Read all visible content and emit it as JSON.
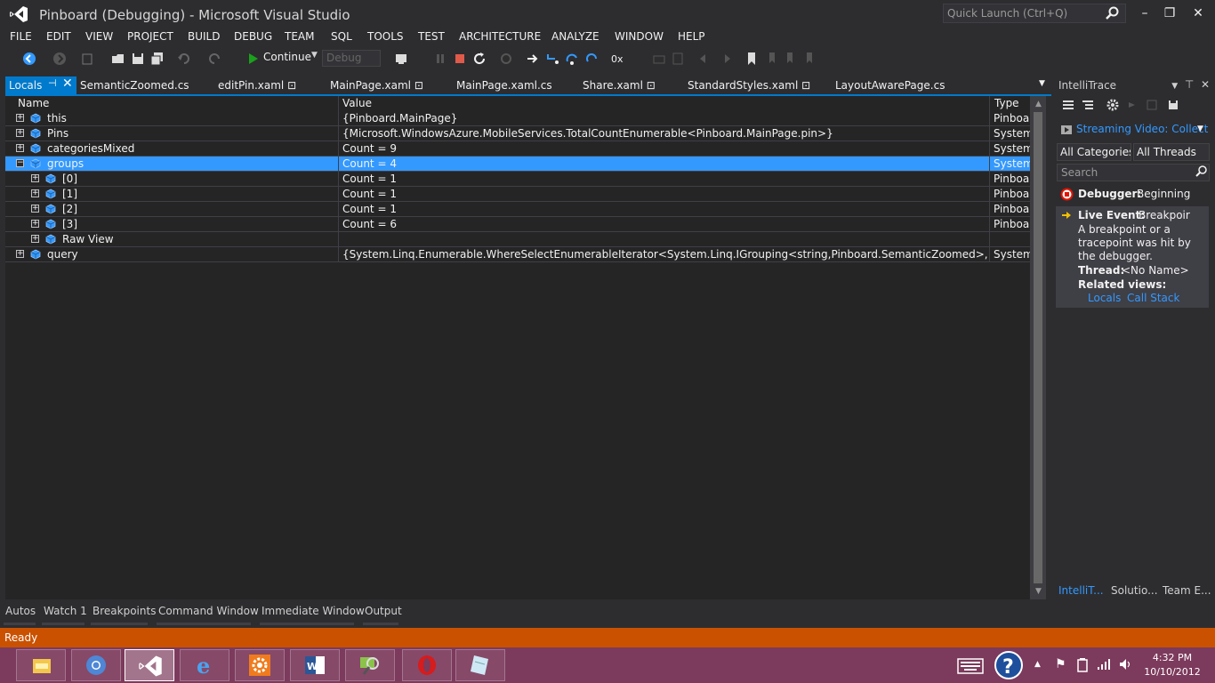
{
  "window": {
    "title": "Pinboard (Debugging) - Microsoft Visual Studio",
    "quick_launch_placeholder": "Quick Launch (Ctrl+Q)"
  },
  "menu": [
    "FILE",
    "EDIT",
    "VIEW",
    "PROJECT",
    "BUILD",
    "DEBUG",
    "TEAM",
    "SQL",
    "TOOLS",
    "TEST",
    "ARCHITECTURE",
    "ANALYZE",
    "WINDOW",
    "HELP"
  ],
  "toolbar": {
    "continue_label": "Continue",
    "configuration": "Debug"
  },
  "tabs": [
    {
      "label": "Locals",
      "active": true
    },
    {
      "label": "SemanticZoomed.cs"
    },
    {
      "label": "editPin.xaml"
    },
    {
      "label": "MainPage.xaml"
    },
    {
      "label": "MainPage.xaml.cs"
    },
    {
      "label": "Share.xaml"
    },
    {
      "label": "StandardStyles.xaml"
    },
    {
      "label": "LayoutAwarePage.cs"
    }
  ],
  "locals": {
    "columns": {
      "name": "Name",
      "value": "Value",
      "type": "Type"
    },
    "rows": [
      {
        "name": "this",
        "value": "{Pinboard.MainPage}",
        "type": "Pinboard.MainPage",
        "expander": "+",
        "depth": 0
      },
      {
        "name": "Pins",
        "value": "{Microsoft.WindowsAzure.MobileServices.TotalCountEnumerable<Pinboard.MainPage.pin>}",
        "type": "System.Collections",
        "expander": "+",
        "depth": 0
      },
      {
        "name": "categoriesMixed",
        "value": "Count = 9",
        "type": "System.Collections",
        "expander": "+",
        "depth": 0
      },
      {
        "name": "groups",
        "value": "Count = 4",
        "type": "System.Collections",
        "expander": "−",
        "depth": 0,
        "selected": true
      },
      {
        "name": "[0]",
        "value": "Count = 1",
        "type": "Pinboard.SemanticZoomed",
        "expander": "+",
        "depth": 1
      },
      {
        "name": "[1]",
        "value": "Count = 1",
        "type": "Pinboard.SemanticZoomed",
        "expander": "+",
        "depth": 1
      },
      {
        "name": "[2]",
        "value": "Count = 1",
        "type": "Pinboard.SemanticZoomed",
        "expander": "+",
        "depth": 1
      },
      {
        "name": "[3]",
        "value": "Count = 6",
        "type": "Pinboard.SemanticZoomed",
        "expander": "+",
        "depth": 1
      },
      {
        "name": "Raw View",
        "value": "",
        "type": "",
        "expander": "+",
        "depth": 1
      },
      {
        "name": "query",
        "value": "{System.Linq.Enumerable.WhereSelectEnumerableIterator<System.Linq.IGrouping<string,Pinboard.SemanticZoomed>,<>f__AnonymousType",
        "type": "System.Collections",
        "expander": "+",
        "depth": 0
      }
    ]
  },
  "bottom_tabs": [
    "Autos",
    "Watch 1",
    "Breakpoints",
    "Command Window",
    "Immediate Window",
    "Output"
  ],
  "status": "Ready",
  "intellitrace": {
    "title": "IntelliTrace",
    "stream_label": "Streaming Video: Collect",
    "categories": "All Categories",
    "threads": "All Threads",
    "search_placeholder": "Search",
    "event1": {
      "label": "Debugger:",
      "text": "Beginning"
    },
    "event2": {
      "label": "Live Event:",
      "text": "Breakpoir",
      "desc1": "A breakpoint or a",
      "desc2": "tracepoint was hit by",
      "desc3": "the debugger.",
      "thread_label": "Thread:",
      "thread_value": "<No Name>",
      "related_label": "Related views:",
      "link_locals": "Locals",
      "link_callstack": "Call Stack"
    },
    "bottom_tabs": [
      "IntelliT...",
      "Solutio...",
      "Team E..."
    ]
  },
  "taskbar": {
    "time": "4:32 PM",
    "date": "10/10/2012"
  },
  "colors": {
    "accent": "#007acc",
    "status_bar": "#ca5100",
    "selection": "#3399ff",
    "taskbar": "#7c3a5c"
  }
}
